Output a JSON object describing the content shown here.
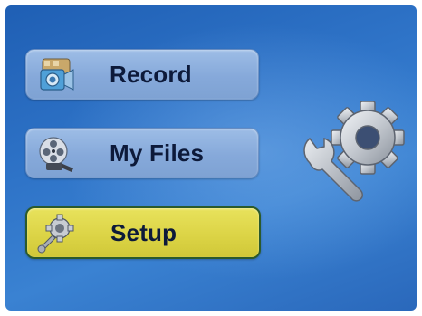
{
  "menu": {
    "items": [
      {
        "label": "Record",
        "icon": "camera-film-icon",
        "selected": false
      },
      {
        "label": "My Files",
        "icon": "film-reel-icon",
        "selected": false
      },
      {
        "label": "Setup",
        "icon": "gear-wrench-icon",
        "selected": true
      }
    ]
  },
  "preview": {
    "icon": "gear-wrench-icon"
  },
  "colors": {
    "background": "#2f74c8",
    "item_normal": "#8fb0de",
    "item_selected": "#ddd548",
    "label_text": "#0d1a3a"
  }
}
